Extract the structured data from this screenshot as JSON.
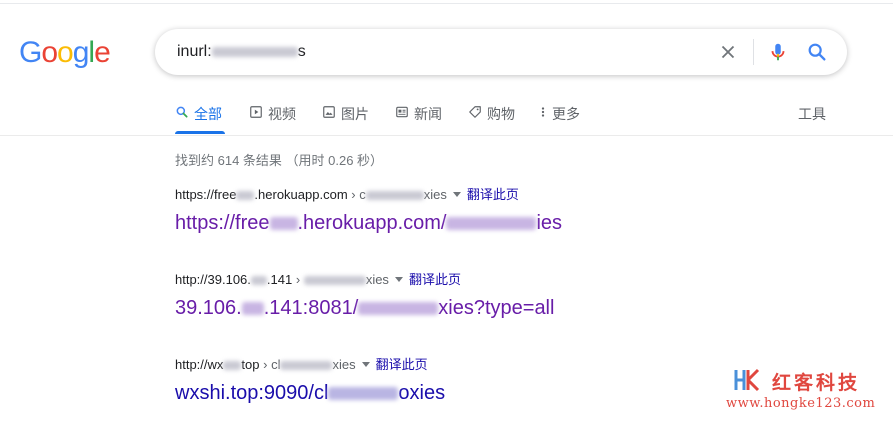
{
  "logo": {
    "text": [
      "G",
      "o",
      "o",
      "g",
      "l",
      "e"
    ],
    "colors": [
      "#4285f4",
      "#ea4335",
      "#fbbc05",
      "#4285f4",
      "#34a853",
      "#ea4335"
    ]
  },
  "search": {
    "query_prefix": "inurl:",
    "query_suffix": "s"
  },
  "tabs": [
    {
      "label": "全部",
      "icon": "search-icon",
      "active": true
    },
    {
      "label": "视频",
      "icon": "play-icon"
    },
    {
      "label": "图片",
      "icon": "image-icon"
    },
    {
      "label": "新闻",
      "icon": "news-icon"
    },
    {
      "label": "购物",
      "icon": "tag-icon"
    },
    {
      "label": "更多",
      "icon": "more-vert-icon"
    }
  ],
  "tools_label": "工具",
  "stats": "找到约 614 条结果 （用时 0.26 秒）",
  "results": [
    {
      "cite_a": "https://free",
      "cite_b": ".herokuapp.com",
      "crumb_sep": "›",
      "crumb_a": "c",
      "crumb_b": "xies",
      "translate": "翻译此页",
      "title_a": "https://free",
      "title_b": ".herokuapp.com/",
      "title_c": "ies"
    },
    {
      "cite_a": "http://39.106.",
      "cite_b": ".141",
      "crumb_sep": "›",
      "crumb_a": "",
      "crumb_b": "xies",
      "translate": "翻译此页",
      "title_a": "39.106.",
      "title_b": ".141:8081/",
      "title_c": "xies?type=all"
    },
    {
      "cite_a": "http://wx",
      "cite_b": "top",
      "crumb_sep": "›",
      "crumb_a": "cl",
      "crumb_b": "xies",
      "translate": "翻译此页",
      "title_a": "wxshi.top:9090/cl",
      "title_b": "",
      "title_c": "oxies"
    }
  ],
  "watermark": {
    "name": "红客科技",
    "url": "www.hongke123.com",
    "color": "#e0473f"
  }
}
